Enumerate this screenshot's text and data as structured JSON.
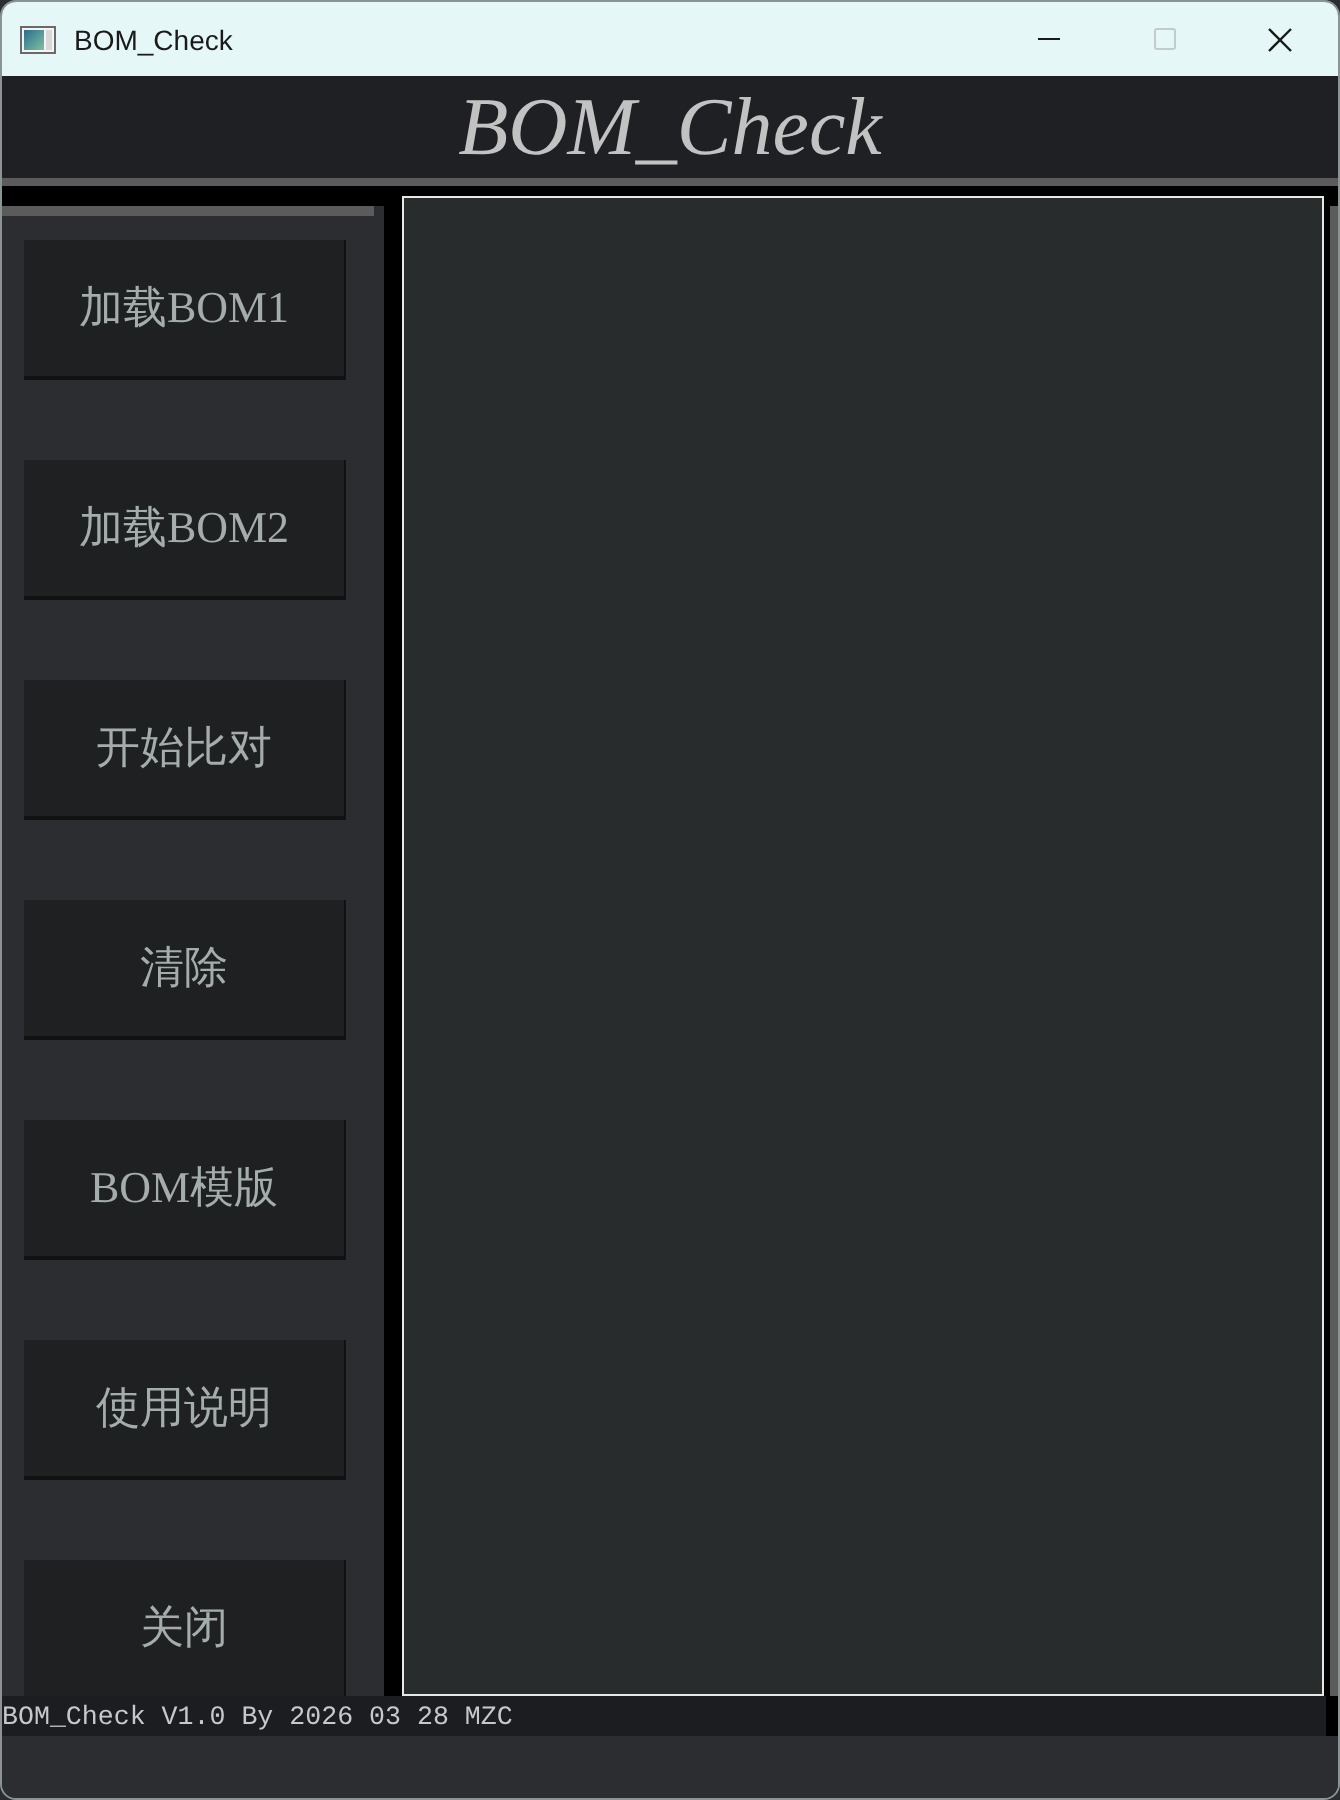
{
  "window": {
    "title": "BOM_Check",
    "controls": [
      {
        "kind": "minimize",
        "disabled": false
      },
      {
        "kind": "maximize",
        "disabled": true
      },
      {
        "kind": "close",
        "disabled": false
      }
    ]
  },
  "header": {
    "title": "BOM_Check"
  },
  "sidebar": {
    "buttons": [
      "加载BOM1",
      "加载BOM2",
      "开始比对",
      "清除",
      "BOM模版",
      "使用说明",
      "关闭"
    ]
  },
  "status_bar": {
    "text": "BOM_Check V1.0 By 2026 03 28 MZC"
  }
}
